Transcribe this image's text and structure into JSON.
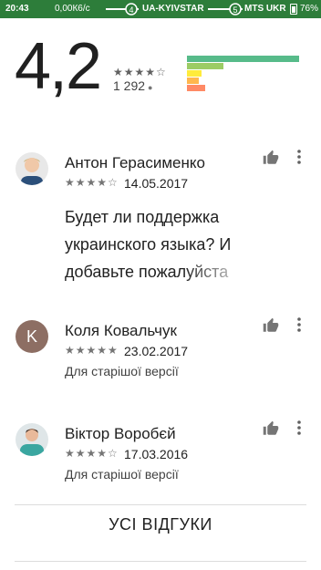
{
  "status_bar": {
    "time": "20:43",
    "speed": "0,00К6/с",
    "sim1_number": "4",
    "carrier1": "UA-KYIVSTAR",
    "sim2_number": "5",
    "carrier2": "MTS UKR",
    "battery": "76%"
  },
  "summary": {
    "average": "4,2",
    "stars_filled": 4,
    "total_reviews": "1 292",
    "histogram": [
      {
        "stars": 5,
        "fraction": 0.93,
        "color": "#57bb8a"
      },
      {
        "stars": 4,
        "fraction": 0.3,
        "color": "#9ccc65"
      },
      {
        "stars": 3,
        "fraction": 0.12,
        "color": "#ffeb3b"
      },
      {
        "stars": 2,
        "fraction": 0.1,
        "color": "#ffb74d"
      },
      {
        "stars": 1,
        "fraction": 0.15,
        "color": "#ff8a65"
      }
    ]
  },
  "reviews": [
    {
      "author": "Антон Герасименко",
      "rating": 4,
      "date": "14.05.2017",
      "text": "Будет ли поддержка украинского языка? И добавьте пожалуйста",
      "version_note": ""
    },
    {
      "author": "Коля Ковальчук",
      "avatar_letter": "K",
      "rating": 5,
      "date": "23.02.2017",
      "text": "",
      "version_note": "Для старішої версії"
    },
    {
      "author": "Віктор Воробєй",
      "rating": 4,
      "date": "17.03.2016",
      "text": "",
      "version_note": "Для старішої версії"
    }
  ],
  "footer": {
    "all_reviews_label": "УСІ ВІДГУКИ"
  }
}
